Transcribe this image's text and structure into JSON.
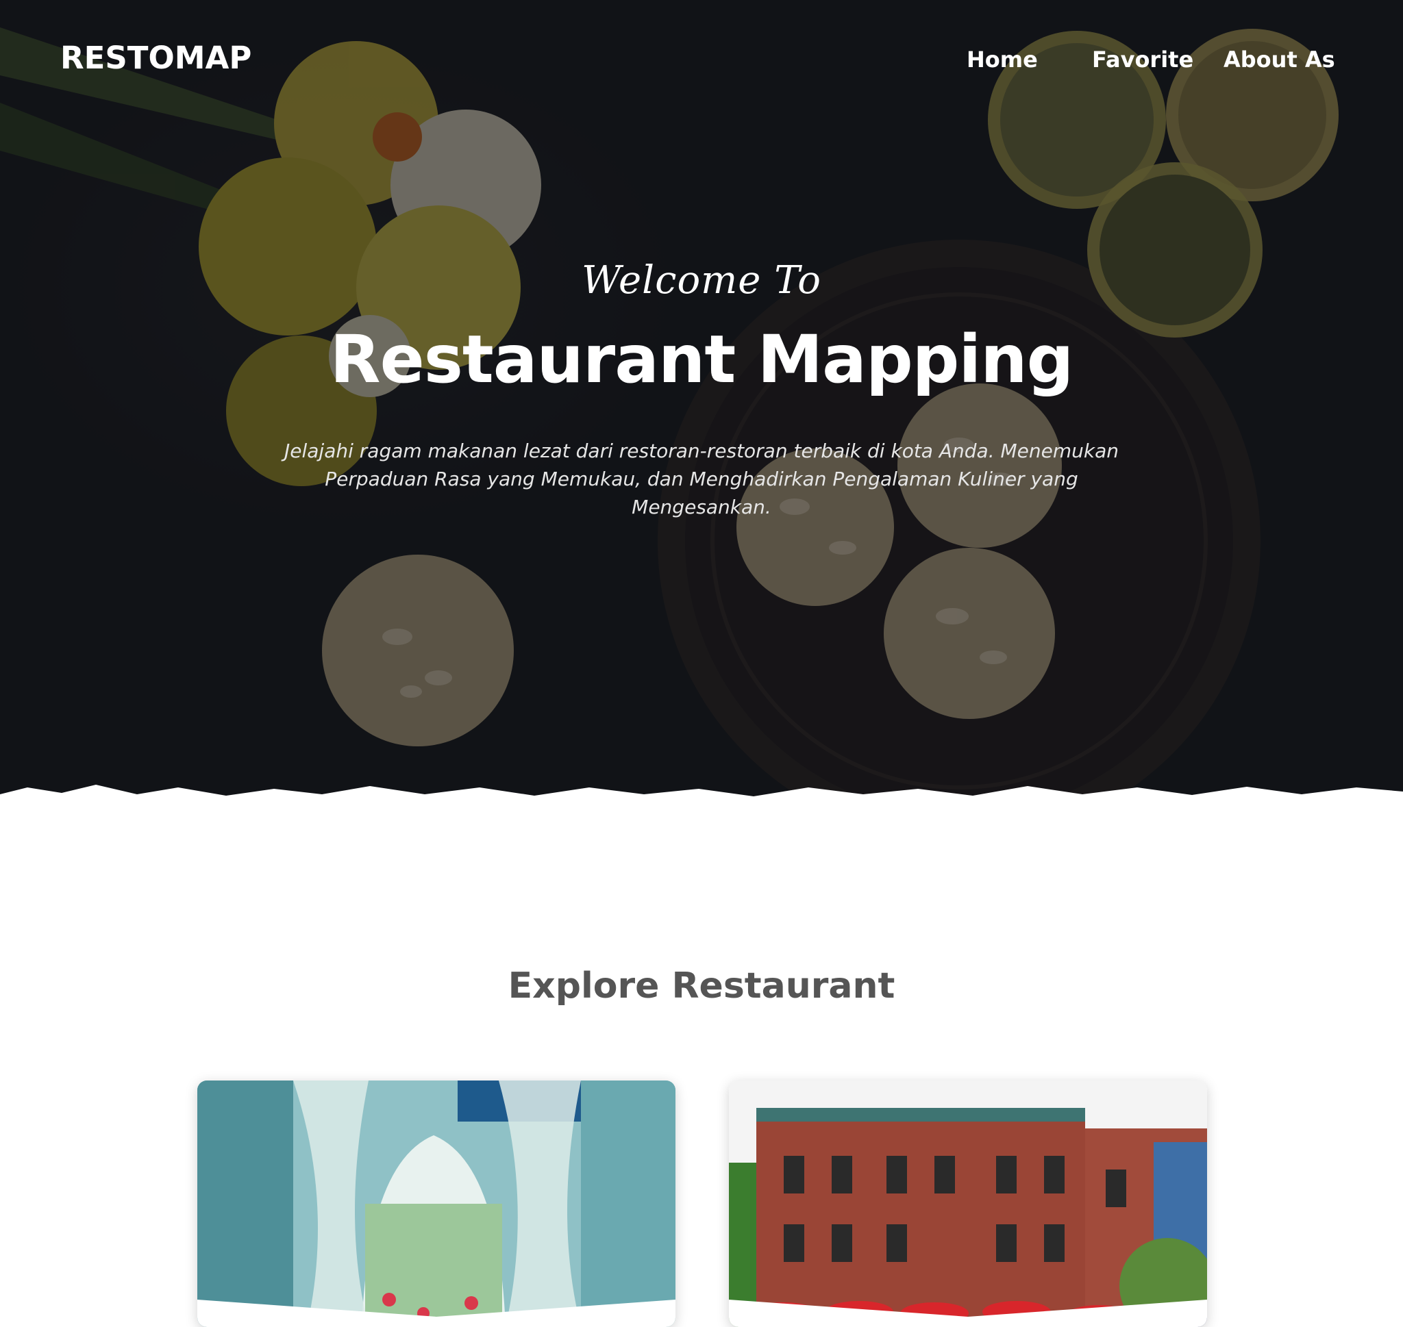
{
  "navbar": {
    "brand": "RESTOMAP",
    "links": [
      {
        "label": "Home"
      },
      {
        "label": "Favorite"
      },
      {
        "label": "About As"
      }
    ]
  },
  "hero": {
    "welcome": "Welcome To",
    "title": "Restaurant Mapping",
    "description": "Jelajahi ragam makanan lezat dari restoran-restoran terbaik di kota Anda. Menemukan Perpaduan Rasa yang Memukau, dan Menghadirkan Pengalaman Kuliner yang Mengesankan."
  },
  "explore": {
    "title": "Explore Restaurant"
  },
  "colors": {
    "hero_dark": "#141519",
    "heading_gray": "#555555",
    "white": "#ffffff"
  }
}
